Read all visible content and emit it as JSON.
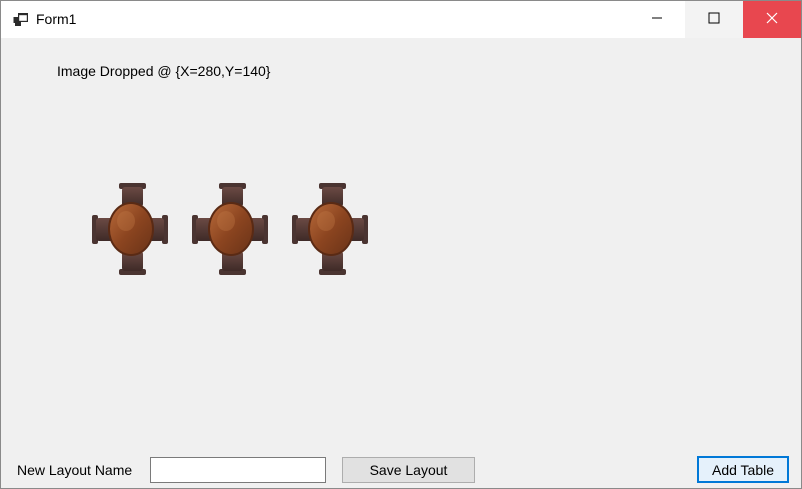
{
  "window": {
    "title": "Form1",
    "icon": "app-form-icon",
    "controls": {
      "minimize": "minimize-icon",
      "maximize": "maximize-icon",
      "close": "close-icon",
      "close_color": "#e8474f"
    }
  },
  "form": {
    "status_text": "Image Dropped @ {X=280,Y=140}",
    "tables": [
      {
        "icon": "dining-table-icon"
      },
      {
        "icon": "dining-table-icon"
      },
      {
        "icon": "dining-table-icon"
      }
    ],
    "layout_name_label": "New Layout Name",
    "layout_name_value": "",
    "save_button_label": "Save Layout",
    "add_table_button_label": "Add Table",
    "focus_color": "#0078d7"
  }
}
